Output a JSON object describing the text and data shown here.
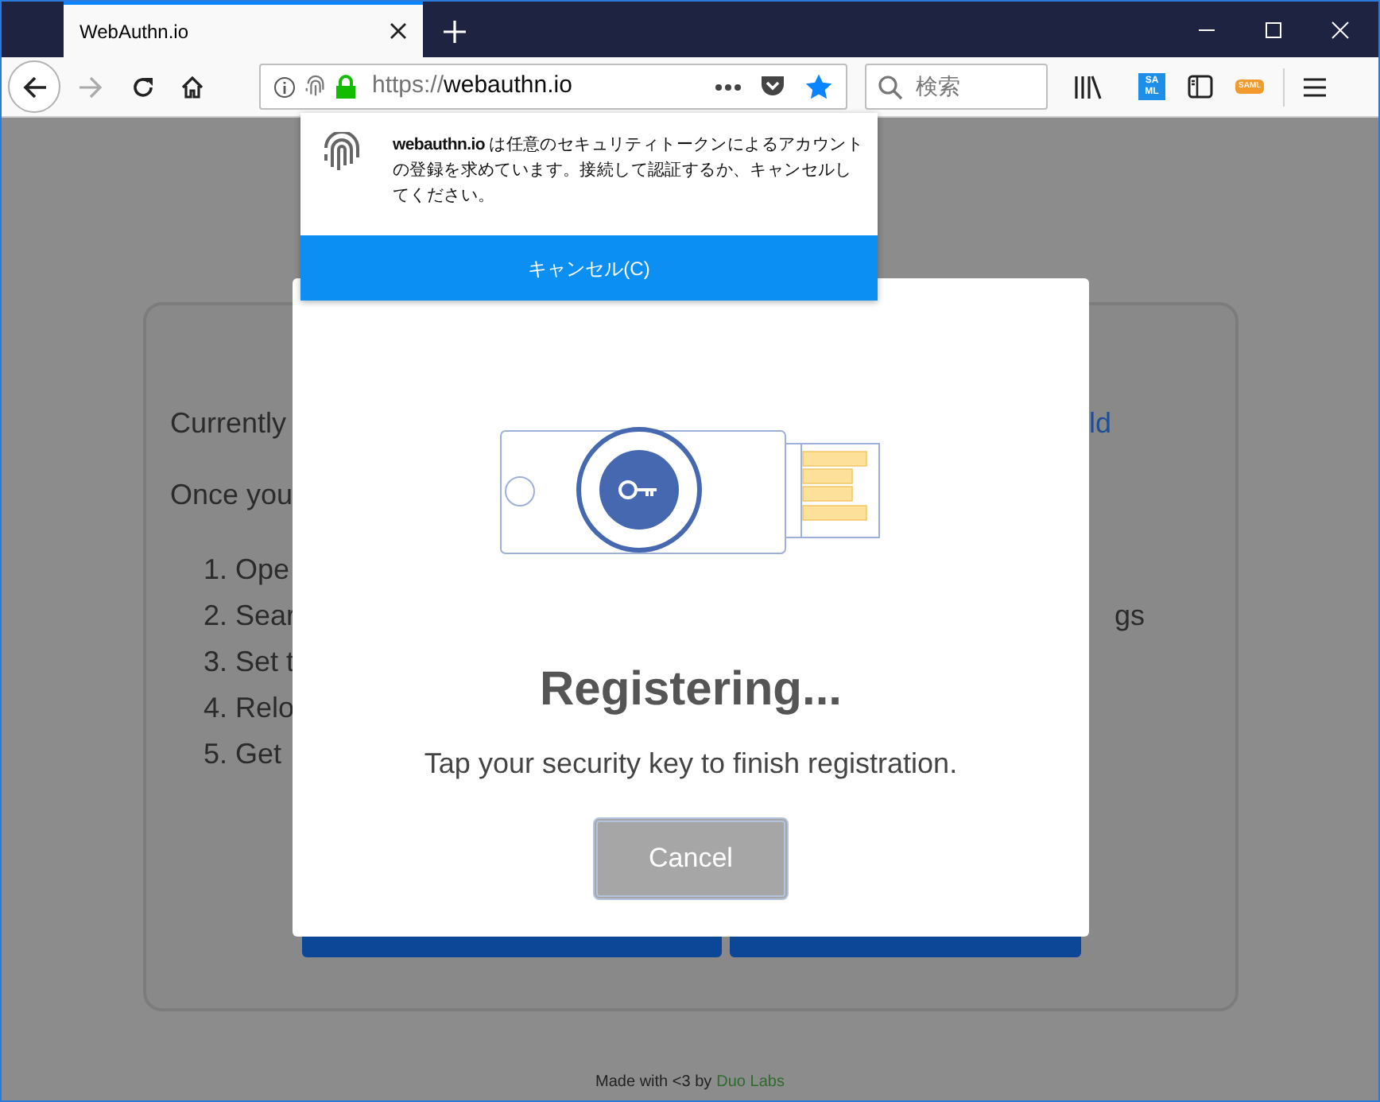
{
  "tabs": [
    {
      "title": "WebAuthn.io",
      "selected": true
    }
  ],
  "toolbar": {
    "url_prefix": "https://",
    "url_domain": "webauthn.io",
    "search_placeholder": "検索",
    "extensions": [
      {
        "kind": "blue",
        "text": "SA ML"
      },
      {
        "kind": "orange",
        "text": "SAML"
      }
    ]
  },
  "permission_popup": {
    "message": "**webauthn.io** は任意のセキュリティトークンによるアカウントの登録を求めています。接続して認証するか、キャンセルしてください。",
    "button": "キャンセル(C)"
  },
  "page": {
    "lines": [
      {
        "left": "Currently",
        "right": {
          "text": "ld",
          "kind": "link"
        }
      },
      {
        "left": "Once you"
      }
    ],
    "steps": [
      {
        "left": "1. Ope"
      },
      {
        "left": "2. Sear",
        "right": {
          "text": "gs",
          "kind": "plain"
        }
      },
      {
        "left": "3. Set t"
      },
      {
        "left": "4. Relo"
      },
      {
        "left": "5. Get"
      }
    ]
  },
  "modal": {
    "title": "Registering...",
    "message": "Tap your security key to finish registration.",
    "button": "Cancel"
  },
  "footer": {
    "text": "Made with <3 by",
    "link": "Duo Labs"
  }
}
